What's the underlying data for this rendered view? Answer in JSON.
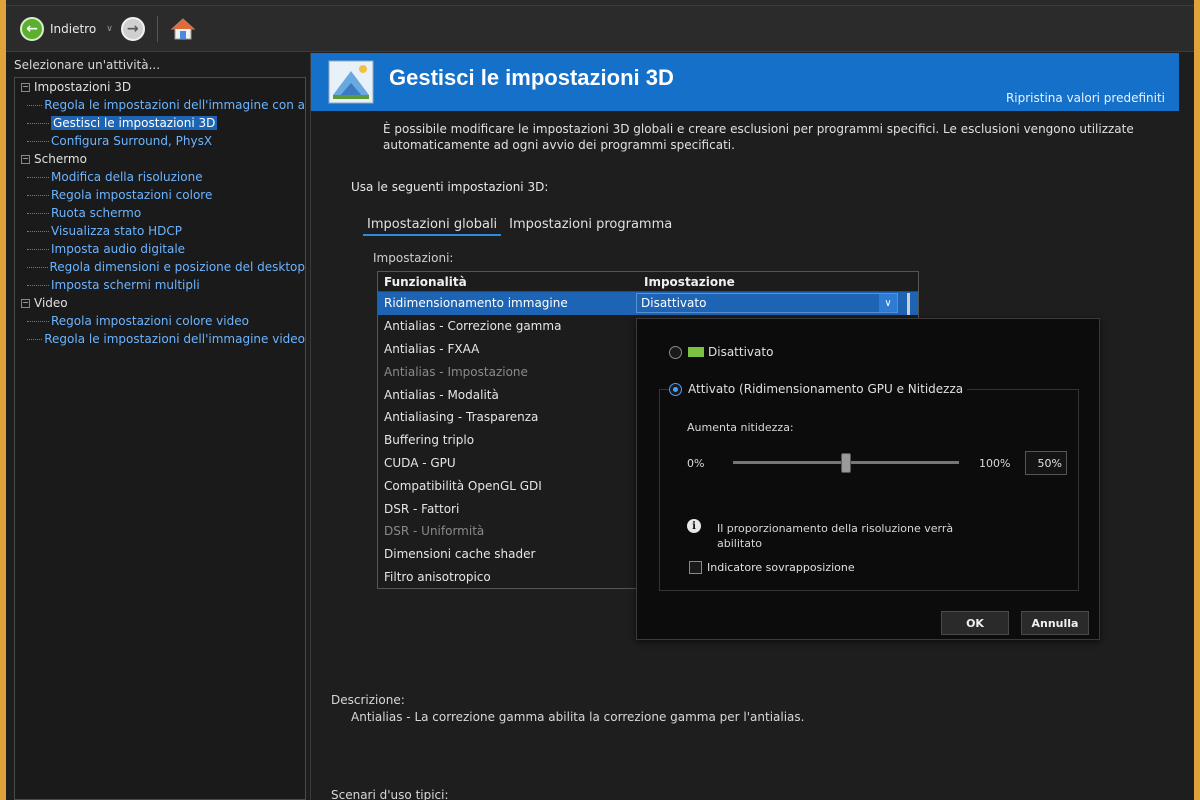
{
  "toolbar": {
    "back_label": "Indietro"
  },
  "left": {
    "task_label": "Selezionare un'attività...",
    "groups": [
      {
        "label": "Impostazioni 3D",
        "items": [
          "Regola le impostazioni dell'immagine con a",
          "Gestisci le impostazioni 3D",
          "Configura Surround, PhysX"
        ]
      },
      {
        "label": "Schermo",
        "items": [
          "Modifica della risoluzione",
          "Regola impostazioni colore",
          "Ruota schermo",
          "Visualizza stato HDCP",
          "Imposta audio digitale",
          "Regola dimensioni e posizione del desktop",
          "Imposta schermi multipli"
        ]
      },
      {
        "label": "Video",
        "items": [
          "Regola impostazioni colore video",
          "Regola le impostazioni dell'immagine video"
        ]
      }
    ],
    "selected_item": "Gestisci le impostazioni 3D"
  },
  "main": {
    "title": "Gestisci le impostazioni 3D",
    "restore_link": "Ripristina valori predefiniti",
    "intro_line1": "È possibile modificare le impostazioni 3D globali e creare esclusioni per programmi specifici. Le esclusioni vengono utilizzate",
    "intro_line2": "automaticamente ad ogni avvio dei programmi specificati.",
    "use_label": "Usa le seguenti impostazioni 3D:",
    "tabs": [
      "Impostazioni globali",
      "Impostazioni programma"
    ],
    "settings_label": "Impostazioni:",
    "grid": {
      "col_feature": "Funzionalità",
      "col_setting": "Impostazione",
      "rows": [
        {
          "feature": "Ridimensionamento immagine",
          "value": "Disattivato"
        },
        {
          "feature": "Antialias - Correzione gamma"
        },
        {
          "feature": "Antialias - FXAA"
        },
        {
          "feature": "Antialias - Impostazione"
        },
        {
          "feature": "Antialias - Modalità"
        },
        {
          "feature": "Antialiasing - Trasparenza"
        },
        {
          "feature": "Buffering triplo"
        },
        {
          "feature": "CUDA - GPU"
        },
        {
          "feature": "Compatibilità OpenGL GDI"
        },
        {
          "feature": "DSR - Fattori"
        },
        {
          "feature": "DSR - Uniformità"
        },
        {
          "feature": "Dimensioni cache shader"
        },
        {
          "feature": "Filtro anisotropico"
        }
      ]
    },
    "popup": {
      "option_off": "Disattivato",
      "option_on": "Attivato (Ridimensionamento GPU e Nitidezza",
      "sharpen_label": "Aumenta nitidezza:",
      "min_label": "0%",
      "max_label": "100%",
      "value": "50%",
      "slider_fraction": 0.5,
      "info_line1": "Il proporzionamento della risoluzione verrà",
      "info_line2": "abilitato",
      "overlay_label": "Indicatore sovrapposizione",
      "ok": "OK",
      "cancel": "Annulla"
    },
    "description_label": "Descrizione:",
    "description_text": "Antialias - La correzione gamma abilita la correzione gamma per l'antialias.",
    "usage_label": "Scenari d'uso tipici:"
  },
  "colors": {
    "banner": "#1470c8",
    "selection": "#1e64b4",
    "link": "#6cb4ff",
    "nvidia_green": "#7ac043"
  }
}
